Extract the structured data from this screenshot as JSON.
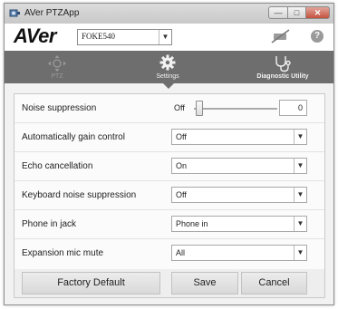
{
  "window": {
    "title": "AVer PTZApp",
    "min_glyph": "—",
    "max_glyph": "□",
    "close_glyph": "✕"
  },
  "header": {
    "logo_text": "AVer",
    "camera_select_value": "FOKE540",
    "help_glyph": "?"
  },
  "tabs": [
    {
      "label": "PTZ",
      "icon": "ptz-arrows-icon",
      "active": false
    },
    {
      "label": "Settings",
      "icon": "gear-icon",
      "active": true
    },
    {
      "label": "Diagnostic Utility",
      "icon": "stethoscope-icon",
      "active": false
    }
  ],
  "settings": {
    "noise_suppression": {
      "label": "Noise suppression",
      "off_label": "Off",
      "value": "0"
    },
    "rows": [
      {
        "label": "Automatically gain control",
        "value": "Off"
      },
      {
        "label": "Echo cancellation",
        "value": "On"
      },
      {
        "label": "Keyboard noise suppression",
        "value": "Off"
      },
      {
        "label": "Phone in jack",
        "value": "Phone in"
      },
      {
        "label": "Expansion mic mute",
        "value": "All"
      }
    ]
  },
  "footer": {
    "factory_default": "Factory Default",
    "save": "Save",
    "cancel": "Cancel"
  },
  "colors": {
    "tabbar_bg": "#6e6e6e",
    "window_bg": "#f2f2f2",
    "close_button": "#c4513f"
  }
}
